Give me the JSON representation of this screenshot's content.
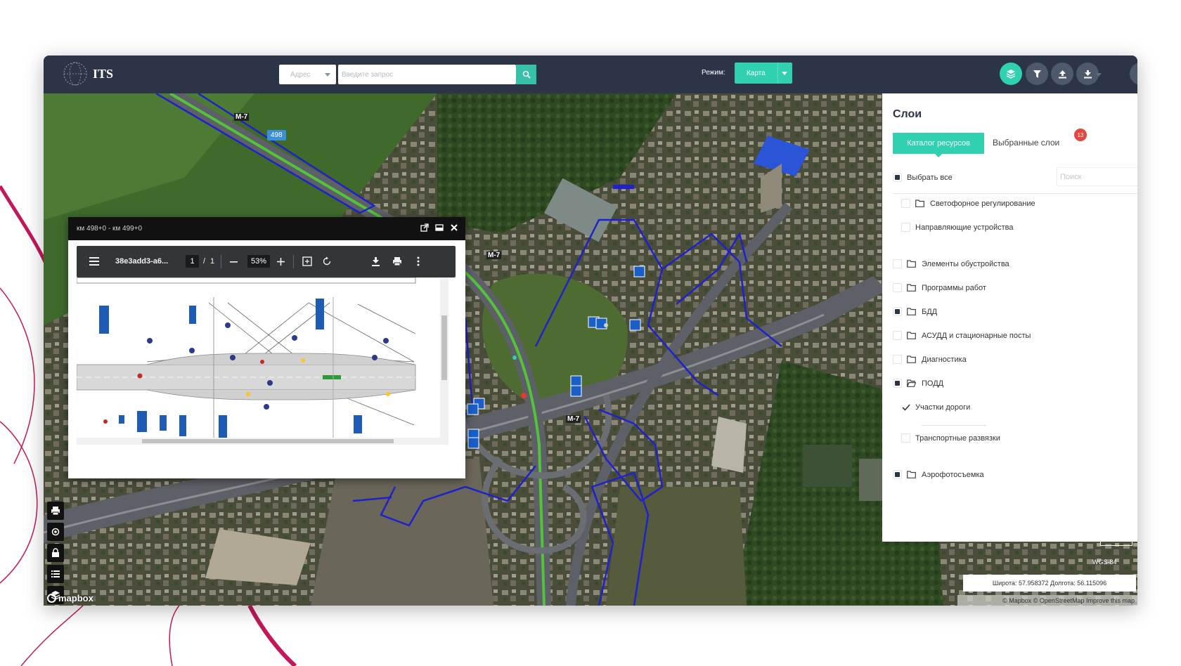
{
  "app": {
    "logo_text": "ITS"
  },
  "search": {
    "address_select": "Адрес",
    "query_placeholder": "Введите запрос"
  },
  "mode": {
    "label": "Режим:",
    "value": "Карта"
  },
  "toolbar_icons": [
    "layers-icon",
    "filter-icon",
    "upload-icon",
    "download-icon",
    "user-icon"
  ],
  "map": {
    "road_labels": [
      "М-7",
      "М-7",
      "М-7"
    ],
    "km_marker": "498",
    "coords": "Широта: 57.958372  Долгота: 56.115096",
    "crs": "WGS-84",
    "attribution": "© Mapbox © OpenStreetMap Improve this map",
    "mapbox_label": "mapbox",
    "left_tools": [
      "print-icon",
      "locate-icon",
      "rule-icon",
      "list-icon",
      "layers-icon"
    ]
  },
  "doc_viewer": {
    "title": "км 498+0 - км 499+0",
    "file_name": "38e3add3-a6...",
    "page_current": "1",
    "page_sep": "/",
    "page_total": "1",
    "zoom": "53%"
  },
  "layers_panel": {
    "title": "Слои",
    "tabs": [
      "Каталог ресурсов",
      "Выбранные слои"
    ],
    "selected_badge": "13",
    "select_all": "Выбрать все",
    "search_placeholder": "Поиск",
    "items": [
      {
        "label": "Светофорное регулирование",
        "state": "unchecked",
        "folder": true,
        "indent": 1
      },
      {
        "label": "Направляющие устройства",
        "state": "unchecked",
        "folder": false,
        "indent": 1
      },
      {
        "label": "Элементы обустройства",
        "state": "unchecked",
        "folder": true,
        "indent": 0
      },
      {
        "label": "Программы работ",
        "state": "unchecked",
        "folder": true,
        "indent": 0
      },
      {
        "label": "БДД",
        "state": "partial",
        "folder": true,
        "indent": 0
      },
      {
        "label": "АСУДД и стационарные посты",
        "state": "unchecked",
        "folder": true,
        "indent": 0
      },
      {
        "label": "Диагностика",
        "state": "unchecked",
        "folder": true,
        "indent": 0
      },
      {
        "label": "ПОДД",
        "state": "partial",
        "folder": true,
        "indent": 0
      },
      {
        "label": "Участки дороги",
        "state": "checked",
        "folder": false,
        "indent": 1
      },
      {
        "label": "Транспортные развязки",
        "state": "unchecked",
        "folder": false,
        "indent": 1
      },
      {
        "label": "Аэрофотосъемка",
        "state": "partial",
        "folder": true,
        "indent": 0
      }
    ]
  },
  "colors": {
    "accent": "#2fd1b1",
    "topbar": "#2b3547",
    "badge": "#e5463d",
    "boundary": "#1f22c8",
    "route": "#54c23a"
  }
}
